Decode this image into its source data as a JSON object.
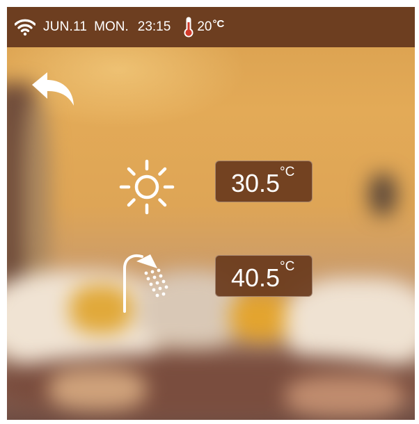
{
  "status_bar": {
    "date": "JUN.11",
    "day": "MON.",
    "time": "23:15",
    "temperature": "20",
    "temperature_unit": "°C",
    "wifi_icon": "wifi-icon",
    "thermometer_icon": "thermometer-icon"
  },
  "back_icon": "back-arrow-icon",
  "rows": [
    {
      "icon": "sun-icon",
      "value": "30.5",
      "unit": "°C"
    },
    {
      "icon": "shower-icon",
      "value": "40.5",
      "unit": "°C"
    }
  ],
  "colors": {
    "status_bar_bg": "#6d3e20",
    "value_box_bg": "#693a1c",
    "thermometer_red": "#d23a2a",
    "text": "#ffffff"
  }
}
